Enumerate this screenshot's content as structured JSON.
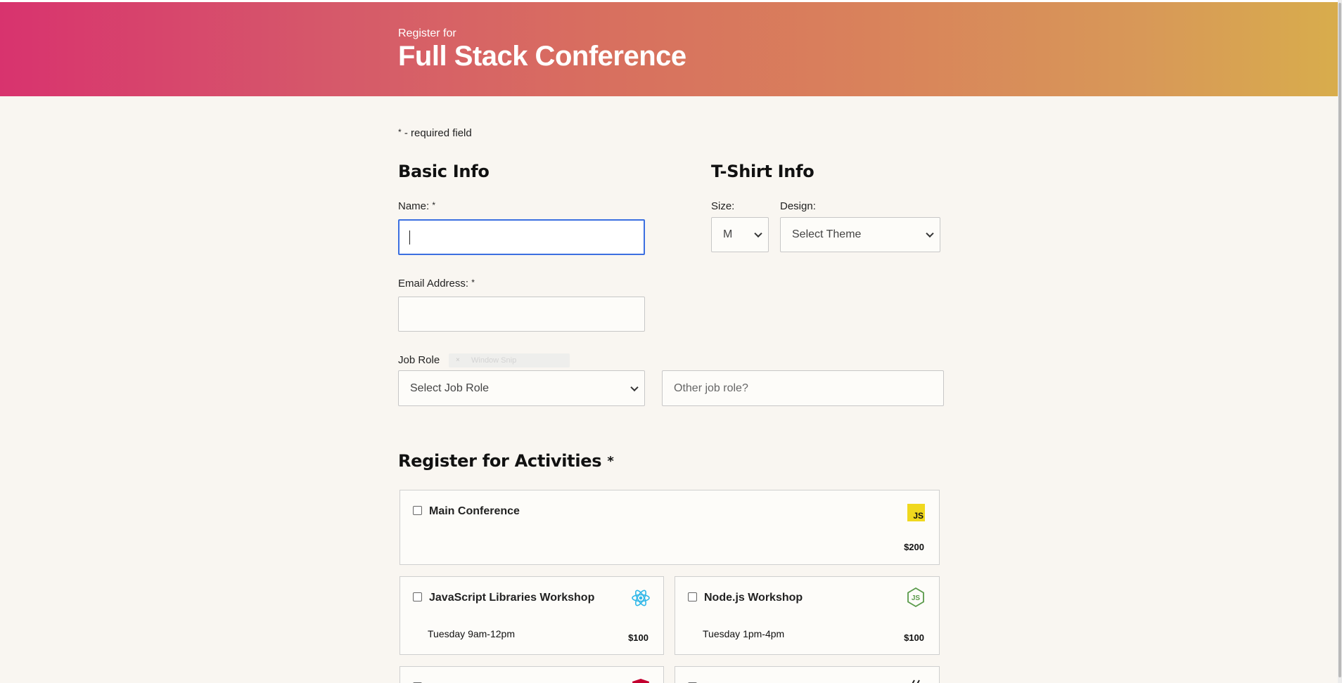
{
  "header": {
    "subtitle": "Register for",
    "title": "Full Stack Conference"
  },
  "form": {
    "required_note": "- required field",
    "required_marker": "*",
    "basic_info": {
      "heading": "Basic Info",
      "name_label": "Name:",
      "name_value": "",
      "email_label": "Email Address:",
      "email_value": "",
      "job_role_label": "Job Role",
      "job_role_selected": "Select Job Role",
      "other_job_placeholder": "Other job role?"
    },
    "tshirt": {
      "heading": "T-Shirt Info",
      "size_label": "Size:",
      "size_selected": "M",
      "design_label": "Design:",
      "design_selected": "Select Theme"
    },
    "activities": {
      "heading": "Register for Activities",
      "items": [
        {
          "name": "Main Conference",
          "time": "",
          "price": "$200",
          "icon": "javascript-icon",
          "checked": false
        },
        {
          "name": "JavaScript Libraries Workshop",
          "time": "Tuesday 9am-12pm",
          "price": "$100",
          "icon": "react-icon",
          "checked": false
        },
        {
          "name": "Node.js Workshop",
          "time": "Tuesday 1pm-4pm",
          "price": "$100",
          "icon": "nodejs-icon",
          "checked": false
        }
      ]
    }
  },
  "overlay": {
    "window_snip_label": "Window Snip",
    "close_glyph": "×"
  },
  "colors": {
    "header_gradient_start": "#d8336e",
    "header_gradient_end": "#d8ad4c",
    "page_background": "#f9f6f1",
    "focus_border": "#3b6fe0",
    "js_badge": "#f0d81e",
    "react_blue": "#2fb7e8",
    "node_green": "#5a9a4a",
    "angular_red": "#c3002f"
  }
}
